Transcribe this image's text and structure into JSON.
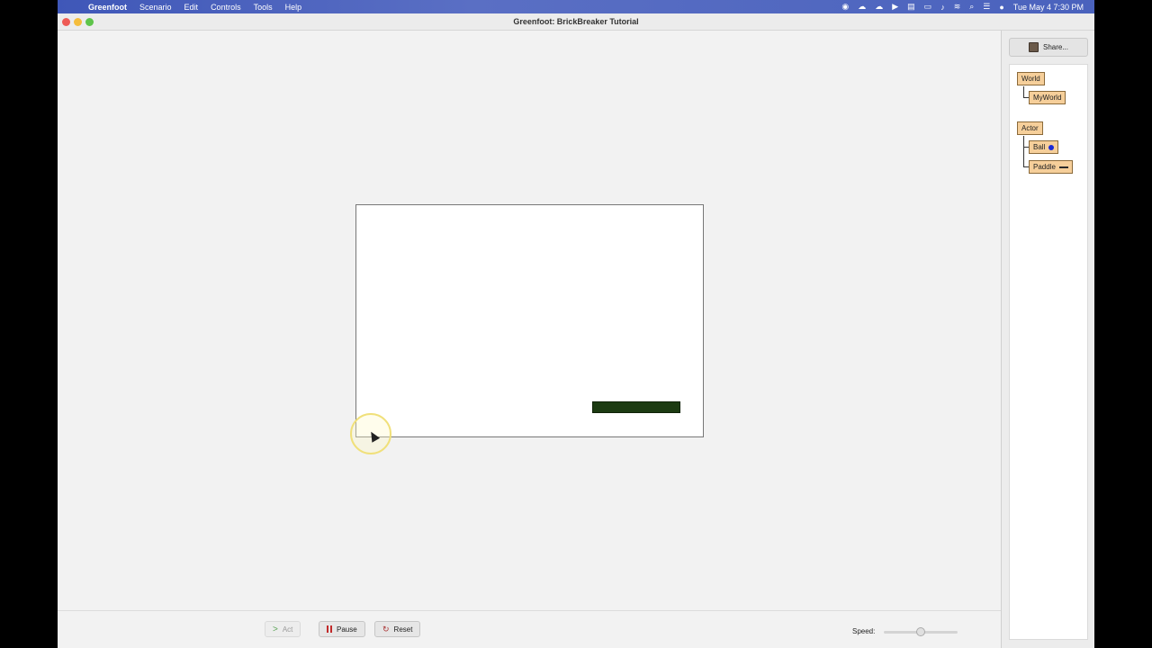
{
  "menubar": {
    "apple": "",
    "app": "Greenfoot",
    "items": [
      "Scenario",
      "Edit",
      "Controls",
      "Tools",
      "Help"
    ],
    "clock": "Tue May 4  7:30 PM"
  },
  "window": {
    "title": "Greenfoot: BrickBreaker Tutorial"
  },
  "sidepanel": {
    "share_label": "Share...",
    "classes": {
      "world": "World",
      "myworld": "MyWorld",
      "actor": "Actor",
      "ball": "Ball",
      "paddle": "Paddle"
    }
  },
  "controls": {
    "act": "Act",
    "pause": "Pause",
    "reset": "Reset",
    "speed_label": "Speed:",
    "speed_value": 0.5
  },
  "colors": {
    "paddle": "#1c3b12",
    "ball": "#1a2ad6",
    "class_fill": "#f6cf9a"
  }
}
